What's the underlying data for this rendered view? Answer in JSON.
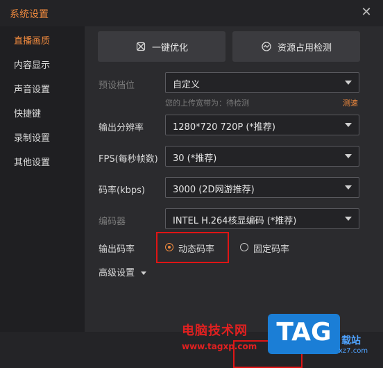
{
  "window": {
    "title": "系统设置",
    "close_glyph": "✕"
  },
  "sidebar": {
    "items": [
      {
        "label": "直播画质",
        "active": true
      },
      {
        "label": "内容显示"
      },
      {
        "label": "声音设置"
      },
      {
        "label": "快捷键"
      },
      {
        "label": "录制设置"
      },
      {
        "label": "其他设置"
      }
    ]
  },
  "toolbar": {
    "optimize_label": "一键优化",
    "resource_label": "资源占用检测"
  },
  "form": {
    "preset": {
      "label": "预设档位",
      "value": "自定义"
    },
    "upload_hint": "您的上传宽带为：待检测",
    "test_link": "测速",
    "resolution": {
      "label": "输出分辨率",
      "value": "1280*720 720P (*推荐)"
    },
    "fps": {
      "label": "FPS(每秒帧数)",
      "value": "30 (*推荐)"
    },
    "bitrate": {
      "label": "码率(kbps)",
      "value": "3000 (2D网游推荐)"
    },
    "encoder": {
      "label": "编码器",
      "value": "INTEL H.264核显编码 (*推荐)"
    },
    "rate_mode": {
      "label": "输出码率",
      "options": [
        {
          "label": "动态码率",
          "selected": true
        },
        {
          "label": "固定码率",
          "selected": false
        }
      ]
    },
    "advanced_label": "高级设置"
  },
  "watermark": {
    "cn": "电脑技术网",
    "url": "www.tagxp.com",
    "tag": "TAG",
    "xz": "载站",
    "site": "xz7.com"
  },
  "colors": {
    "accent": "#f08a3e",
    "highlight": "#e01515"
  }
}
